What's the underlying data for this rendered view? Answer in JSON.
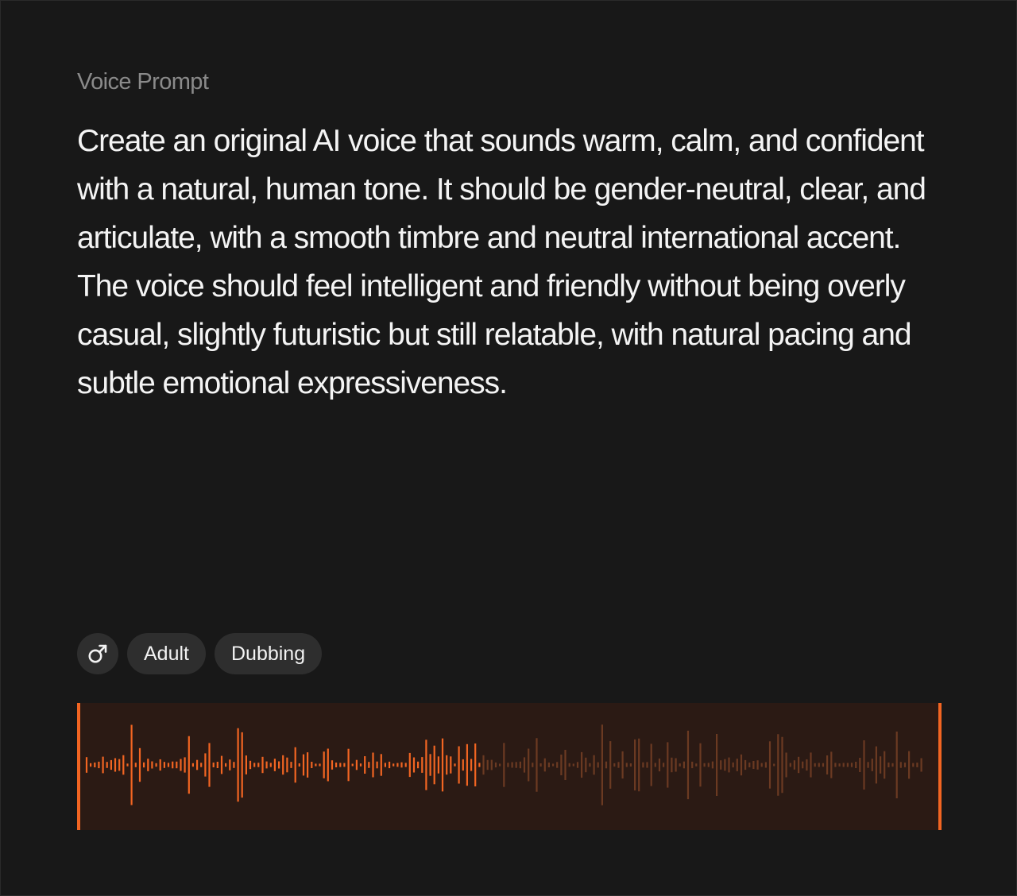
{
  "voice_prompt": {
    "label": "Voice Prompt",
    "text": "Create an original AI voice that sounds warm, calm, and confident with a natural, human tone. It should be gender-neutral, clear, and articulate, with a smooth timbre and neutral international accent. The voice should feel intelligent and friendly without being overly casual, slightly futuristic but still relatable, with natural pacing and subtle emotional expressiveness."
  },
  "tags": {
    "gender_icon": "male-symbol-icon",
    "age": "Adult",
    "use_case": "Dubbing"
  },
  "waveform": {
    "played_fraction": 0.47,
    "colors": {
      "played": "#f26522",
      "unplayed": "#6b3a22",
      "background": "#2b1a14",
      "edge": "#f26522"
    }
  }
}
